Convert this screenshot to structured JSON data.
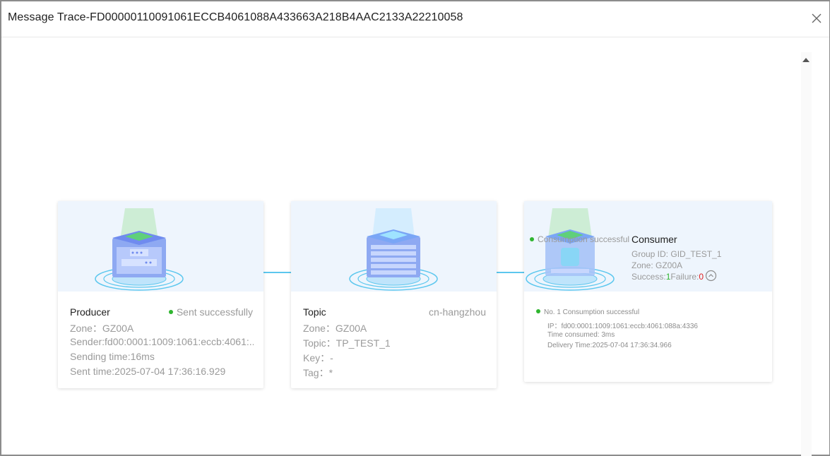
{
  "dialog": {
    "title": "Message Trace-FD00000110091061ECCB4061088A433663A218B4AAC2133A22210058"
  },
  "producer": {
    "title": "Producer",
    "status": "Sent successfully",
    "zone": "Zone：GZ00A",
    "sender": "Sender:fd00:0001:1009:1061:eccb:4061:...",
    "sending_time": "Sending time:16ms",
    "sent_time": "Sent time:2025-07-04 17:36:16.929"
  },
  "topic": {
    "title": "Topic",
    "region": "cn-hangzhou",
    "zone": "Zone：GZ00A",
    "topic": "Topic：TP_TEST_1",
    "key": "Key：-",
    "tag": "Tag：*"
  },
  "consumer": {
    "title": "Consumer",
    "status_overlay": "Consumption successful",
    "group_id": "Group ID: GID_TEST_1",
    "zone": "Zone: GZ00A",
    "success_label": "Success:",
    "success_count": "1",
    "failure_label": "Failure:",
    "failure_count": "0",
    "record_status": "No. 1 Consumption successful",
    "record_ip": "IP：fd00:0001:1009:1061:eccb:4061:088a:4336",
    "record_time_consumed": "Time consumed: 3ms",
    "record_delivery_time": "Delivery Time:2025-07-04 17:36:34.966"
  },
  "colors": {
    "success": "#2fb52f",
    "failure": "#e02020",
    "connector": "#5cc7ee",
    "card_top": "#eef5fd"
  },
  "icons": [
    "close-icon",
    "producer-server-icon",
    "topic-server-icon",
    "consumer-server-icon",
    "collapse-up-icon",
    "scroll-up-arrow-icon"
  ]
}
